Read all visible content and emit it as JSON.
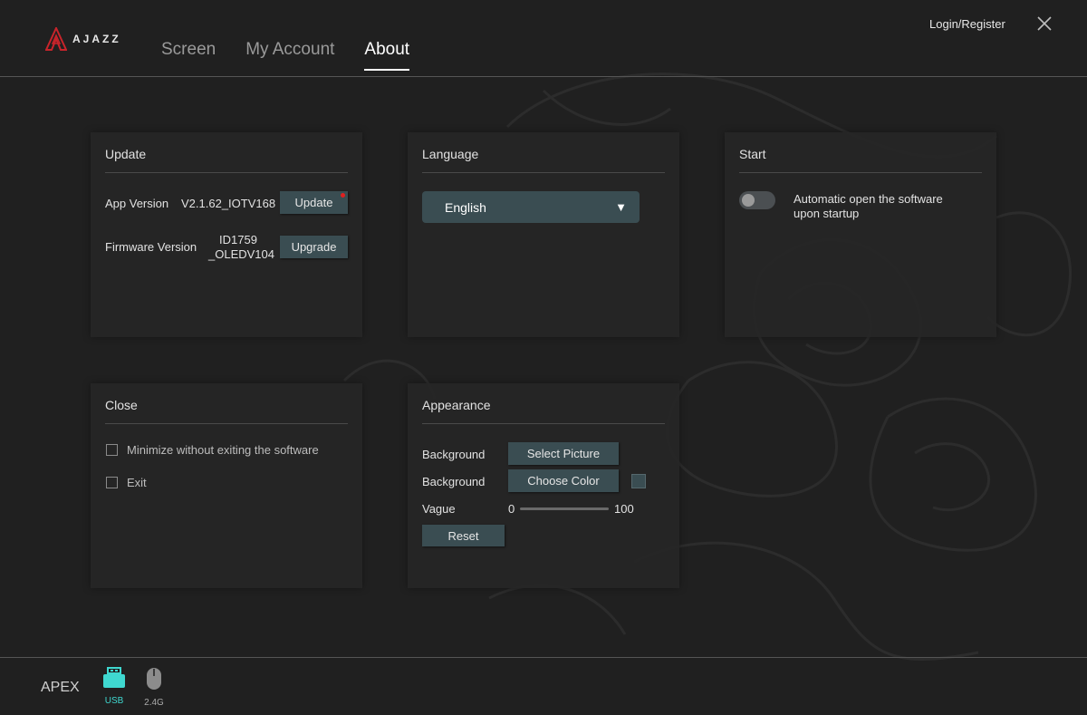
{
  "app": {
    "logo_text": "AJAZZ"
  },
  "nav": {
    "tabs": [
      {
        "label": "Screen"
      },
      {
        "label": "My Account"
      },
      {
        "label": "About"
      }
    ],
    "active": "About"
  },
  "header": {
    "login_label": "Login/Register"
  },
  "update_panel": {
    "title": "Update",
    "app_version_label": "App Version",
    "app_version_value": "V2.1.62_IOTV168",
    "update_button": "Update",
    "firmware_label": "Firmware Version",
    "firmware_value_line1": "ID1759",
    "firmware_value_line2": "_OLEDV104",
    "upgrade_button": "Upgrade"
  },
  "language_panel": {
    "title": "Language",
    "selected": "English"
  },
  "start_panel": {
    "title": "Start",
    "auto_open_line1": "Automatic open the software",
    "auto_open_line2": "upon startup",
    "auto_open_enabled": false
  },
  "close_panel": {
    "title": "Close",
    "options": [
      {
        "label": "Minimize without exiting the software",
        "checked": false
      },
      {
        "label": "Exit",
        "checked": false
      }
    ]
  },
  "appearance_panel": {
    "title": "Appearance",
    "bg_picture_label": "Background",
    "select_picture_button": "Select Picture",
    "bg_color_label": "Background",
    "choose_color_button": "Choose Color",
    "swatch_color": "#3a4d52",
    "vague_label": "Vague",
    "vague_min": "0",
    "vague_max": "100",
    "reset_button": "Reset"
  },
  "footer": {
    "device_name": "APEX",
    "usb_label": "USB",
    "wireless_label": "2.4G",
    "usb_color": "#3fd8d0"
  },
  "colors": {
    "accent_red": "#e02020",
    "button_bg": "#3a4d52"
  }
}
